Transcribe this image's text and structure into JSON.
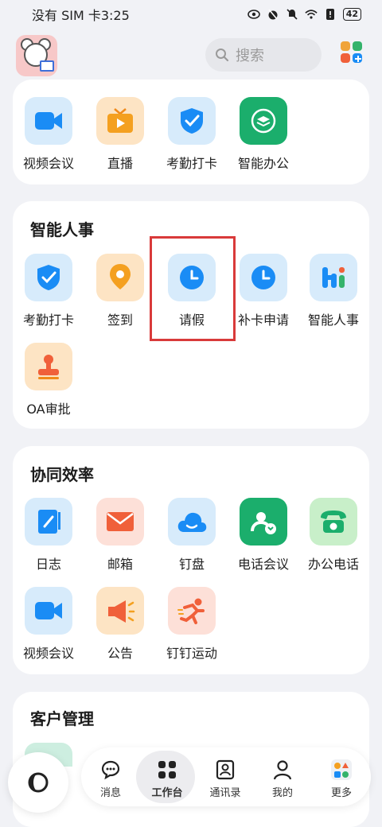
{
  "status_bar": {
    "carrier_time": "没有 SIM 卡3:25",
    "battery": "42"
  },
  "header": {
    "search_placeholder": "搜索"
  },
  "top_section": {
    "apps": [
      {
        "label": "视频会议",
        "icon": "video-camera-icon"
      },
      {
        "label": "直播",
        "icon": "tv-play-icon"
      },
      {
        "label": "考勤打卡",
        "icon": "shield-check-icon"
      },
      {
        "label": "智能办公",
        "icon": "layers-icon"
      }
    ]
  },
  "hr_section": {
    "title": "智能人事",
    "apps": [
      {
        "label": "考勤打卡",
        "icon": "shield-check-icon"
      },
      {
        "label": "签到",
        "icon": "location-pin-icon"
      },
      {
        "label": "请假",
        "icon": "clock-icon"
      },
      {
        "label": "补卡申请",
        "icon": "clock-icon"
      },
      {
        "label": "智能人事",
        "icon": "hi-logo-icon"
      },
      {
        "label": "OA审批",
        "icon": "stamp-icon"
      }
    ]
  },
  "collab_section": {
    "title": "协同效率",
    "apps": [
      {
        "label": "日志",
        "icon": "notebook-pen-icon"
      },
      {
        "label": "邮箱",
        "icon": "mail-icon"
      },
      {
        "label": "钉盘",
        "icon": "cloud-icon"
      },
      {
        "label": "电话会议",
        "icon": "phone-contact-icon"
      },
      {
        "label": "办公电话",
        "icon": "telephone-icon"
      },
      {
        "label": "视频会议",
        "icon": "video-camera-icon"
      },
      {
        "label": "公告",
        "icon": "megaphone-icon"
      },
      {
        "label": "钉钉运动",
        "icon": "runner-icon"
      }
    ]
  },
  "crm_section": {
    "title": "客户管理"
  },
  "tabbar": {
    "tabs": [
      {
        "label": "消息",
        "icon": "chat-bubble-icon"
      },
      {
        "label": "工作台",
        "icon": "grid-icon",
        "active": true
      },
      {
        "label": "通讯录",
        "icon": "contacts-icon"
      },
      {
        "label": "我的",
        "icon": "person-icon"
      },
      {
        "label": "更多",
        "icon": "more-apps-icon"
      }
    ]
  },
  "colors": {
    "accent_blue": "#1a8cf5",
    "highlight_red": "#d93a3a"
  }
}
